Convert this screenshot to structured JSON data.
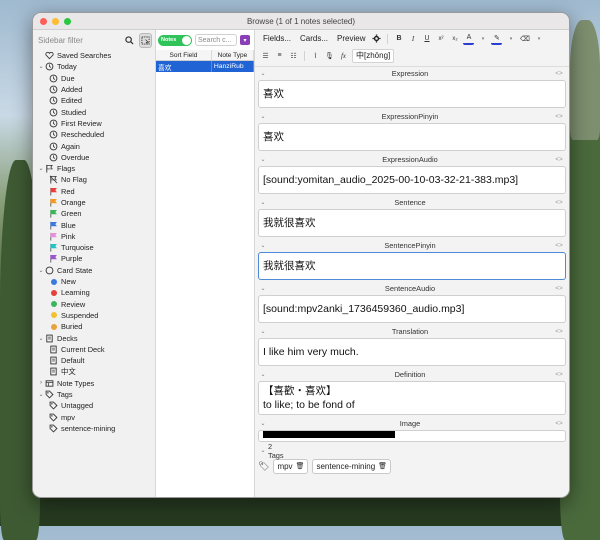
{
  "window": {
    "title": "Browse (1 of 1 notes selected)"
  },
  "sidebar": {
    "search_placeholder": "Sidebar filter",
    "items": [
      {
        "label": "Saved Searches",
        "level": 0,
        "icon": "heart-icon",
        "chev": ""
      },
      {
        "label": "Today",
        "level": 0,
        "icon": "calendar-icon",
        "chev": "open"
      },
      {
        "label": "Due",
        "level": 1,
        "icon": "clock-icon"
      },
      {
        "label": "Added",
        "level": 1,
        "icon": "clock-icon"
      },
      {
        "label": "Edited",
        "level": 1,
        "icon": "clock-icon"
      },
      {
        "label": "Studied",
        "level": 1,
        "icon": "clock-icon"
      },
      {
        "label": "First Review",
        "level": 1,
        "icon": "clock-icon"
      },
      {
        "label": "Rescheduled",
        "level": 1,
        "icon": "clock-icon"
      },
      {
        "label": "Again",
        "level": 1,
        "icon": "clock-icon"
      },
      {
        "label": "Overdue",
        "level": 1,
        "icon": "clock-icon"
      },
      {
        "label": "Flags",
        "level": 0,
        "icon": "flag-icon",
        "chev": "open"
      },
      {
        "label": "No Flag",
        "level": 1,
        "icon": "no-flag-icon"
      },
      {
        "label": "Red",
        "level": 1,
        "icon": "flag-icon",
        "color": "#e5403a"
      },
      {
        "label": "Orange",
        "level": 1,
        "icon": "flag-icon",
        "color": "#f49a22"
      },
      {
        "label": "Green",
        "level": 1,
        "icon": "flag-icon",
        "color": "#3bb65a"
      },
      {
        "label": "Blue",
        "level": 1,
        "icon": "flag-icon",
        "color": "#3c78e0"
      },
      {
        "label": "Pink",
        "level": 1,
        "icon": "flag-icon",
        "color": "#e68fd9"
      },
      {
        "label": "Turquoise",
        "level": 1,
        "icon": "flag-icon",
        "color": "#27c2c2"
      },
      {
        "label": "Purple",
        "level": 1,
        "icon": "flag-icon",
        "color": "#9a55cf"
      },
      {
        "label": "Card State",
        "level": 0,
        "icon": "circle-outline-icon",
        "chev": "open"
      },
      {
        "label": "New",
        "level": 1,
        "icon": "dot-icon",
        "color": "#3c78e0"
      },
      {
        "label": "Learning",
        "level": 1,
        "icon": "dot-icon",
        "color": "#e5403a"
      },
      {
        "label": "Review",
        "level": 1,
        "icon": "dot-icon",
        "color": "#3bb65a"
      },
      {
        "label": "Suspended",
        "level": 1,
        "icon": "dot-icon",
        "color": "#f2c230"
      },
      {
        "label": "Buried",
        "level": 1,
        "icon": "dot-icon",
        "color": "#e8a33a"
      },
      {
        "label": "Decks",
        "level": 0,
        "icon": "deck-icon",
        "chev": "open"
      },
      {
        "label": "Current Deck",
        "level": 1,
        "icon": "deck-icon"
      },
      {
        "label": "Default",
        "level": 1,
        "icon": "deck-icon"
      },
      {
        "label": "中文",
        "level": 1,
        "icon": "deck-icon"
      },
      {
        "label": "Note Types",
        "level": 0,
        "icon": "notetype-icon",
        "chev": "closed"
      },
      {
        "label": "Tags",
        "level": 0,
        "icon": "tag-icon",
        "chev": "open"
      },
      {
        "label": "Untagged",
        "level": 1,
        "icon": "tag-icon"
      },
      {
        "label": "mpv",
        "level": 1,
        "icon": "tag-icon"
      },
      {
        "label": "sentence-mining",
        "level": 1,
        "icon": "tag-icon"
      }
    ]
  },
  "table": {
    "toggle_label": "Notes",
    "search_placeholder": "Search c...",
    "columns": [
      "Sort Field",
      "Note Type"
    ],
    "rows": [
      [
        "喜欢",
        "HanziRub"
      ]
    ]
  },
  "toolbar": {
    "fields_label": "Fields...",
    "cards_label": "Cards...",
    "preview_label": "Preview",
    "ruby_label": "中[zhōng]"
  },
  "fields": [
    {
      "name": "Expression",
      "lines": [
        "喜欢"
      ]
    },
    {
      "name": "ExpressionPinyin",
      "lines": [
        "喜欢"
      ]
    },
    {
      "name": "ExpressionAudio",
      "lines": [
        "[sound:yomitan_audio_2025-00-10-03-32-21-383.mp3]"
      ]
    },
    {
      "name": "Sentence",
      "lines": [
        "我就很喜欢"
      ]
    },
    {
      "name": "SentencePinyin",
      "lines": [
        "我就很喜欢"
      ],
      "focused": true
    },
    {
      "name": "SentenceAudio",
      "lines": [
        "[sound:mpv2anki_1736459360_audio.mp3]"
      ]
    },
    {
      "name": "Translation",
      "lines": [
        "I like him very much."
      ]
    },
    {
      "name": "Definition",
      "lines": [
        "【喜歡・喜欢】",
        "to like; to be fond of"
      ]
    },
    {
      "name": "Image",
      "lines": []
    }
  ],
  "tags": {
    "header": "2 Tags",
    "items": [
      "mpv",
      "sentence-mining"
    ]
  },
  "colors": {
    "accent": "#2063d4",
    "toggle": "#30c35a"
  }
}
